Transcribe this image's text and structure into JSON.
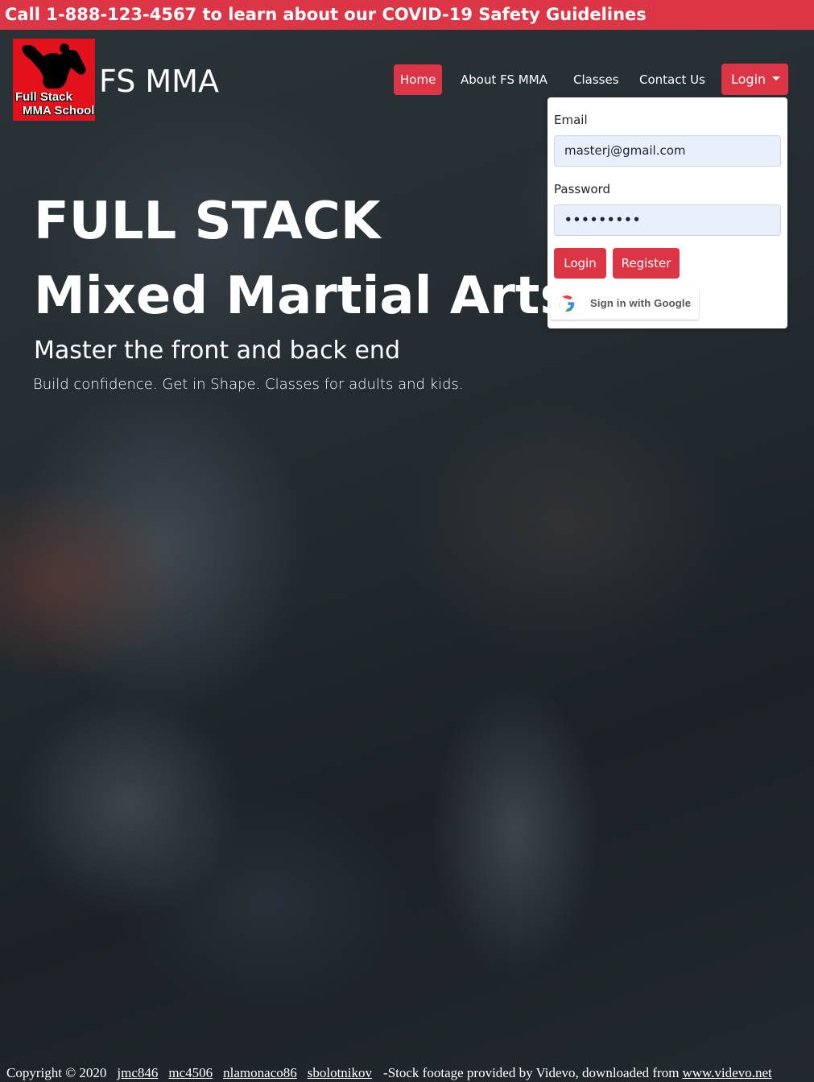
{
  "banner": {
    "text": "Call 1-888-123-4567 to learn about our COVID-19 Safety Guidelines"
  },
  "logo": {
    "line1": "Full Stack",
    "line2": "MMA School"
  },
  "brand": {
    "title": "FS MMA"
  },
  "nav": {
    "home": "Home",
    "about": "About FS MMA",
    "classes": "Classes",
    "contact": "Contact Us",
    "login": "Login"
  },
  "login_form": {
    "email_label": "Email",
    "email_value": "masterj@gmail.com",
    "password_label": "Password",
    "password_value": "•••••••••",
    "login_button": "Login",
    "register_button": "Register",
    "google_button": "Sign in with Google"
  },
  "hero": {
    "line1": "FULL STACK",
    "line2": "Mixed Martial Arts",
    "tagline": "Master the front and back end",
    "subtext": "Build confidence. Get in Shape. Classes for adults and kids."
  },
  "footer": {
    "copyright": "Copyright © 2020",
    "authors": [
      "jmc846",
      "mc4506",
      "nlamonaco86",
      "sbolotnikov"
    ],
    "credit": "-Stock footage provided by Videvo, downloaded from",
    "credit_link": "www.videvo.net"
  },
  "colors": {
    "accent": "#dc3545",
    "logo_red": "#e3111b",
    "input_bg": "#e8f0fe"
  },
  "icons": {
    "logo": "fighter-silhouette-icon",
    "google": "google-g-icon",
    "caret": "caret-down-icon"
  }
}
